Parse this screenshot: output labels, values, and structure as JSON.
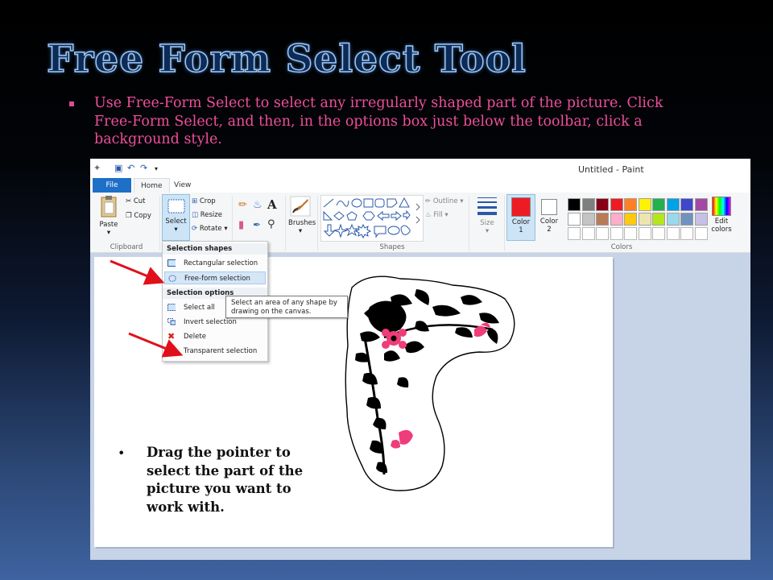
{
  "slide": {
    "title": "Free Form Select Tool",
    "intro": "Use Free-Form Select to select any irregularly shaped part of the picture. Click Free-Form Select, and then, in the options box just below the toolbar, click a background style.",
    "caption": "Drag the pointer to select the part of the picture you want to work with.",
    "bullet_glyph": "•"
  },
  "paint": {
    "window_title": "Untitled - Paint",
    "tabs": [
      "File",
      "Home",
      "View"
    ],
    "clipboard": {
      "paste": "Paste",
      "cut": "Cut",
      "copy": "Copy",
      "group": "Clipboard"
    },
    "image": {
      "select": "Select",
      "crop": "Crop",
      "resize": "Resize",
      "rotate": "Rotate"
    },
    "brushes": "Brushes",
    "shapes": {
      "outline": "Outline",
      "fill": "Fill",
      "group": "Shapes"
    },
    "size": "Size",
    "color1": [
      "Color",
      "1"
    ],
    "color2": [
      "Color",
      "2"
    ],
    "edit_colors": [
      "Edit",
      "colors"
    ],
    "colors_group": "Colors",
    "palette_row1": [
      "#000000",
      "#7f7f7f",
      "#880015",
      "#ed1c24",
      "#ff7f27",
      "#fff200",
      "#22b14c",
      "#00a2e8",
      "#3f48cc",
      "#a349a4"
    ],
    "palette_row2": [
      "#ffffff",
      "#c3c3c3",
      "#b97a57",
      "#ffaec9",
      "#ffc90e",
      "#efe4b0",
      "#b5e61d",
      "#99d9ea",
      "#7092be",
      "#c8bfe7"
    ],
    "color1_value": "#ed1c24",
    "menu": {
      "header_shapes": "Selection shapes",
      "rect": "Rectangular selection",
      "freeform": "Free-form selection",
      "header_options": "Selection options",
      "select_all": "Select all",
      "invert": "Invert selection",
      "delete": "Delete",
      "transparent": "Transparent selection"
    },
    "tooltip": "Select an area of any shape by drawing on the canvas."
  }
}
